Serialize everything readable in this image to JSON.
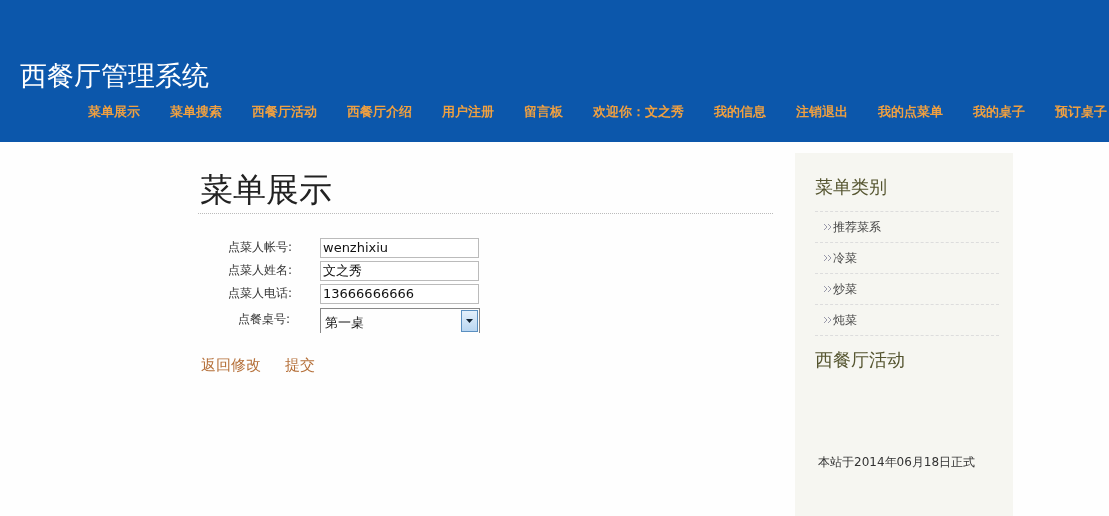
{
  "site_title": "西餐厅管理系统",
  "nav": [
    {
      "label": "菜单展示"
    },
    {
      "label": "菜单搜索"
    },
    {
      "label": "西餐厅活动"
    },
    {
      "label": "西餐厅介绍"
    },
    {
      "label": "用户注册"
    },
    {
      "label": "留言板"
    },
    {
      "label": "欢迎你：文之秀"
    },
    {
      "label": "我的信息"
    },
    {
      "label": "注销退出"
    },
    {
      "label": "我的点菜单"
    },
    {
      "label": "我的桌子"
    },
    {
      "label": "预订桌子"
    }
  ],
  "page_title": "菜单展示",
  "form": [
    {
      "kind": "text",
      "label": "点菜人帐号:",
      "value": "wenzhixiu"
    },
    {
      "kind": "text",
      "label": "点菜人姓名:",
      "value": "文之秀"
    },
    {
      "kind": "text",
      "label": "点菜人电话:",
      "value": "13666666666"
    },
    {
      "kind": "select",
      "label": "点餐桌号:",
      "value": "第一桌"
    }
  ],
  "actions": [
    "返回修改",
    "提交"
  ],
  "sidebar": {
    "categories_title": "菜单类别",
    "categories": [
      "推荐菜系",
      "冷菜",
      "炒菜",
      "炖菜"
    ],
    "activities_title": "西餐厅活动",
    "notice": "本站于2014年06月18日正式"
  }
}
